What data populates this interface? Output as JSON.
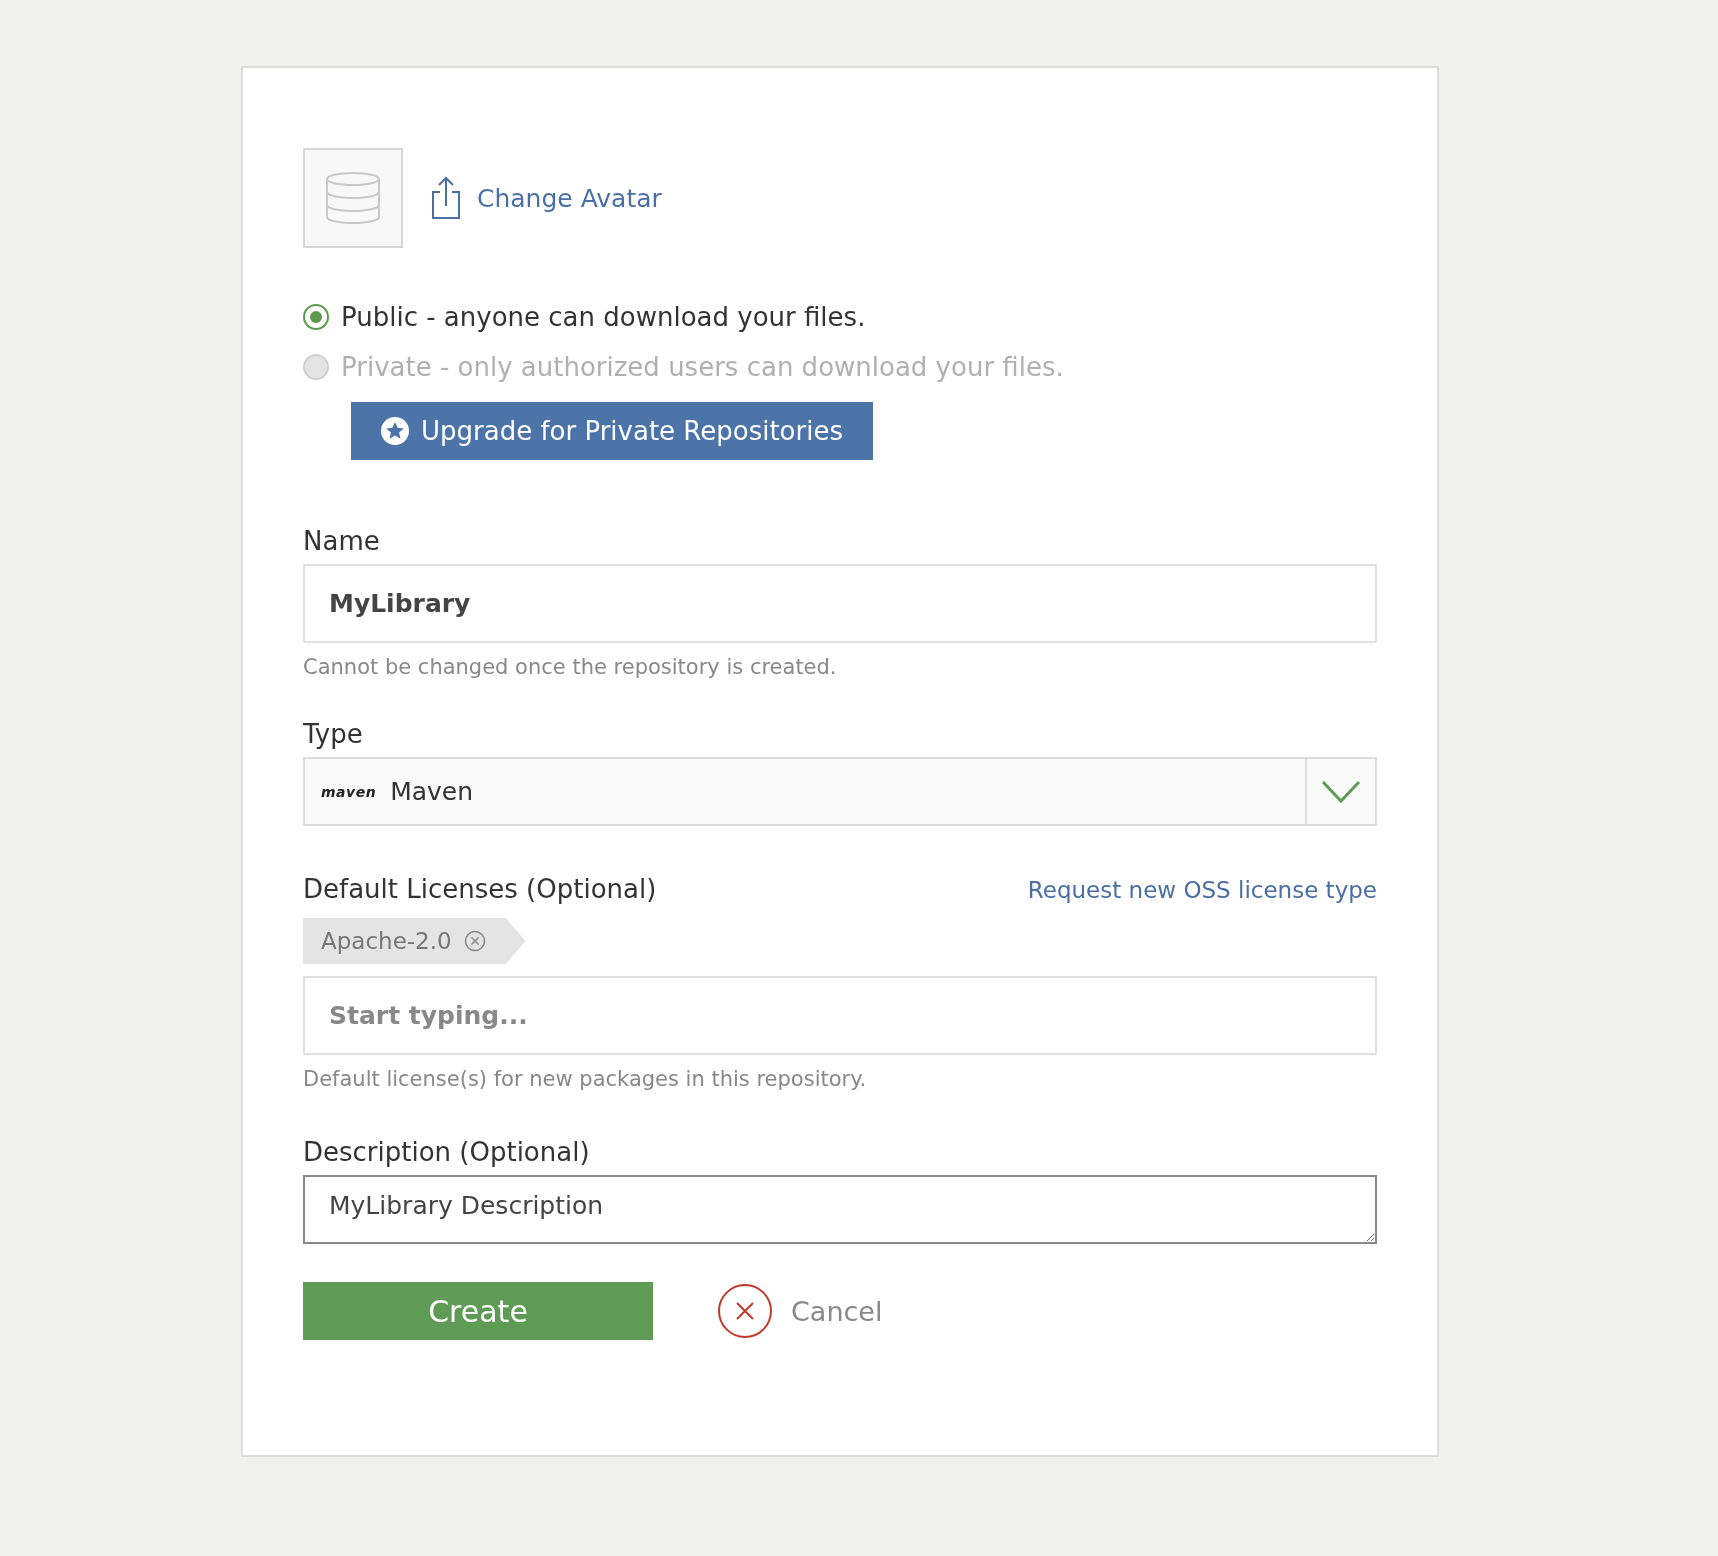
{
  "avatar": {
    "action": "Change Avatar"
  },
  "visibility": [
    {
      "label": "Public - anyone can download your files.",
      "selected": true,
      "disabled": false
    },
    {
      "label": "Private - only authorized users can download your files.",
      "selected": false,
      "disabled": true
    }
  ],
  "upgrade_button": "Upgrade for Private Repositories",
  "name_field": {
    "label": "Name",
    "value": "MyLibrary",
    "help": "Cannot be changed once the repository is created."
  },
  "type_field": {
    "label": "Type",
    "logo": "maven",
    "value": "Maven"
  },
  "licenses": {
    "label": "Default Licenses (Optional)",
    "link": "Request new OSS license type",
    "tags": [
      "Apache-2.0"
    ],
    "placeholder": "Start typing...",
    "help": "Default license(s) for new packages in this repository."
  },
  "description_field": {
    "label": "Description (Optional)",
    "value": "MyLibrary Description"
  },
  "buttons": {
    "create": "Create",
    "cancel": "Cancel"
  }
}
